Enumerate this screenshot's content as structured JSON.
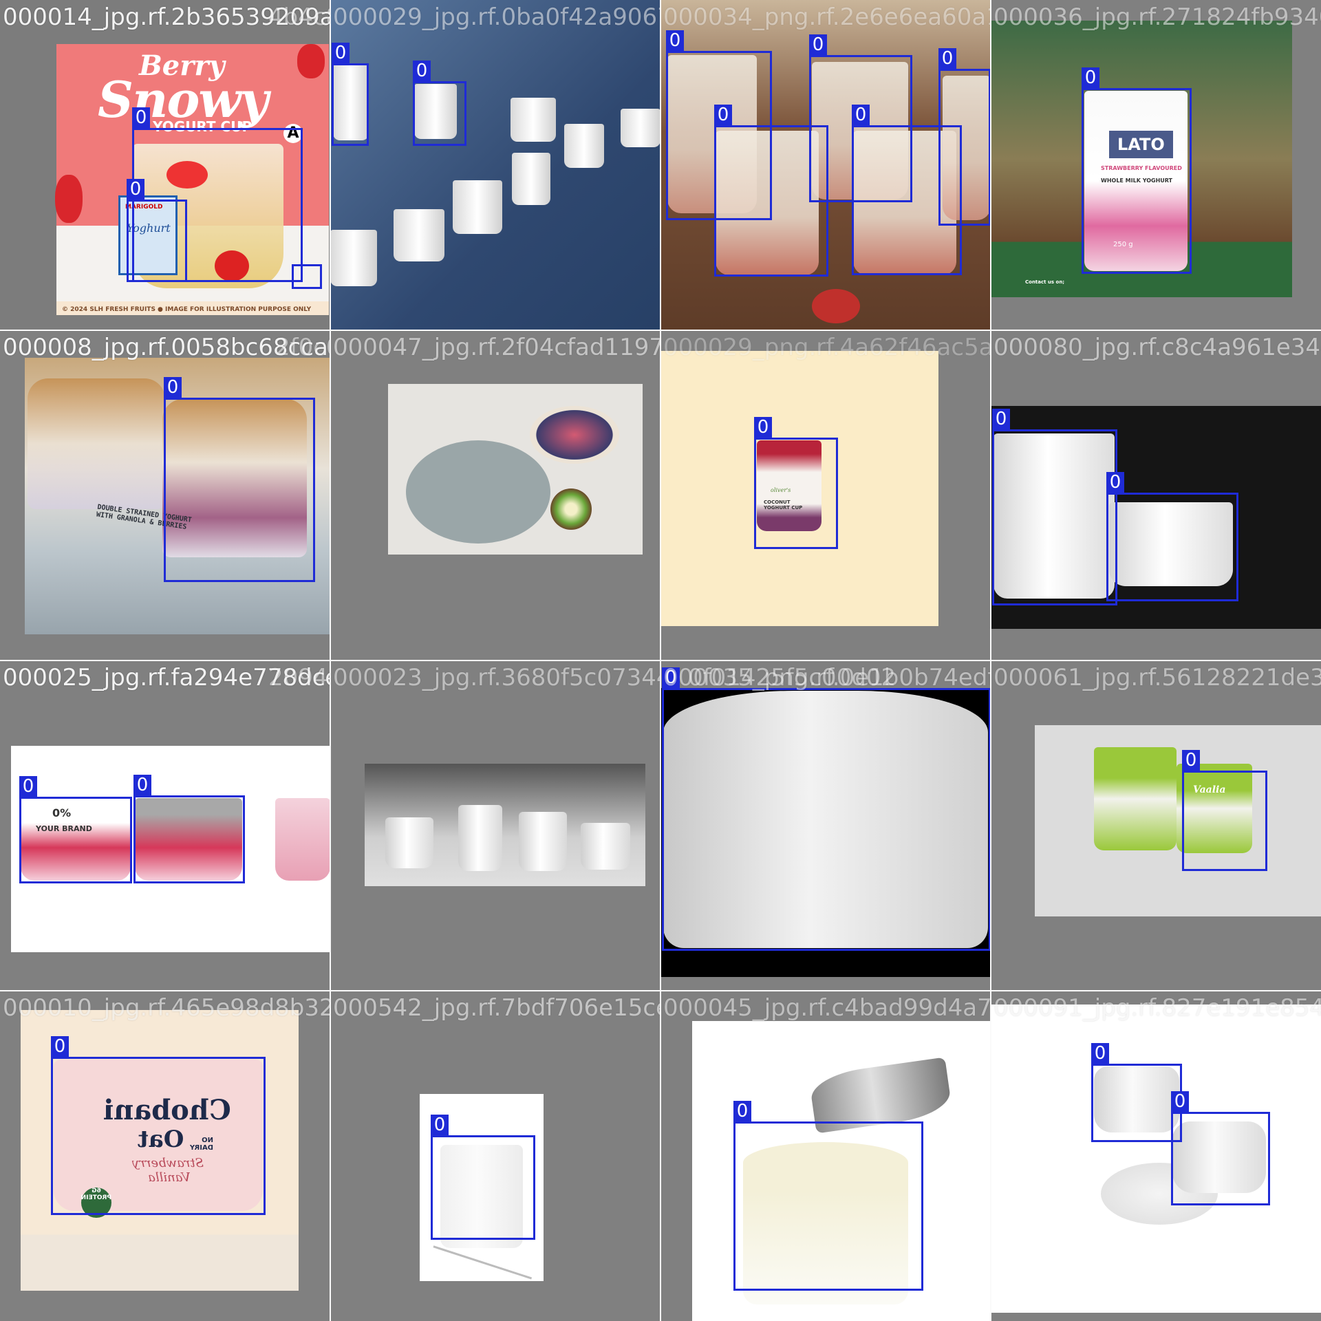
{
  "mosaic": {
    "class_label": "0",
    "box_color": "#1f2bd6",
    "tiles": [
      {
        "id": "t0",
        "filename": "000014_jpg.rf.2b36539209a",
        "overlay_filename": "4b4c829ae70088f042a9067b6",
        "poster": {
          "line1": "Berry",
          "line2": "Snowy",
          "line3": "YOGURT CUP",
          "footer": "© 2024 SLH FRESH FRUITS   ● IMAGE FOR ILLUSTRATION PURPOSE ONLY",
          "pack_brand": "MARIGOLD",
          "pack_name": "Yoghurt",
          "badge": "A"
        }
      },
      {
        "id": "t1",
        "filename": "000029_jpg.rf.0ba0f42a9067b6",
        "overlay_filename": ""
      },
      {
        "id": "t2",
        "filename": "000034_png.rf.2e6e6ea60a1",
        "overlay_filename": ""
      },
      {
        "id": "t3",
        "filename": "000036_jpg.rf.271824fb9340",
        "overlay_filename": "5503614049e56",
        "product": {
          "brand": "LATO",
          "flavour": "STRAWBERRY FLAVOURED",
          "type": "WHOLE MILK YOGHURT",
          "weight": "250 g",
          "contact": "Contact us on;"
        }
      },
      {
        "id": "t4",
        "filename": "000008_jpg.rf.0058bc68cca",
        "overlay_filename": "2f0c047d4bff2f04cfad1197",
        "shelf_label": "DOUBLE STRAINED YOGHURT WITH GRANOLA & BERRIES"
      },
      {
        "id": "t5",
        "filename": "000047_jpg.rf.2f04cfad1197",
        "overlay_filename": ""
      },
      {
        "id": "t6",
        "filename": "000029_png.rf.4a62f46ac5ae1",
        "overlay_filename": "",
        "product": {
          "brand": "oliver's",
          "name": "COCONUT YOGHURT CUP"
        }
      },
      {
        "id": "t7",
        "filename": "000080_jpg.rf.c8c4a961e34c",
        "overlay_filename": "0700801631"
      },
      {
        "id": "t8",
        "filename": "000025_jpg.rf.fa294e778dce",
        "overlay_filename": "209407323c39680f5c073449",
        "product": {
          "fat": "0%",
          "brand": "YOUR BRAND"
        }
      },
      {
        "id": "t9",
        "filename": "000023_jpg.rf.3680f5c073449",
        "overlay_filename": ""
      },
      {
        "id": "t10",
        "filename": "000035_png.rf.0e1b0b74edf",
        "overlay_filename": "0f01425f5c00d02"
      },
      {
        "id": "t11",
        "filename": "000061_jpg.rf.56128221de36",
        "overlay_filename": "4006601ce8e55524",
        "product": {
          "brand": "Vaalia"
        }
      },
      {
        "id": "t12",
        "filename": "000010_jpg.rf.465e98d8b32",
        "overlay_filename": "",
        "product": {
          "brand": "Chobani",
          "line": "Oat",
          "flavour": "Strawberry Vanilla",
          "no_dairy": "NO DAIRY",
          "protein": "6G PROTEIN"
        }
      },
      {
        "id": "t13",
        "filename": "000542_jpg.rf.7bdf706e15ce",
        "overlay_filename": "d4d81b7f"
      },
      {
        "id": "t14",
        "filename": "000045_jpg.rf.c4bad99d4a75",
        "overlay_filename": "0f00040b1dbf"
      },
      {
        "id": "t15",
        "filename": "000091_jpg.rf.827e191e854",
        "overlay_filename": "4f0691a68a3e"
      }
    ]
  }
}
